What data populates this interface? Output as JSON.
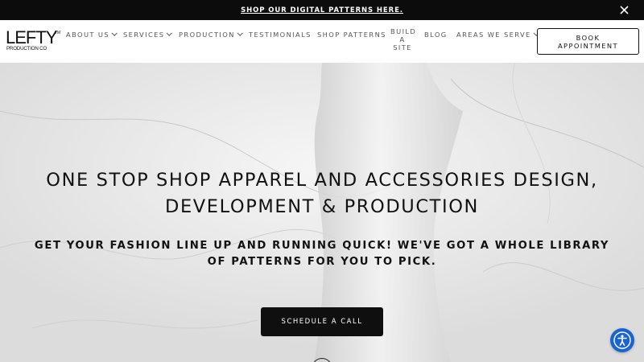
{
  "announcement": {
    "text": "SHOP OUR DIGITAL PATTERNS HERE.",
    "close_icon": "close-icon"
  },
  "header": {
    "logo": {
      "word": "LEFTY",
      "tm": "TM",
      "sub": "PRODUCTION CO"
    },
    "nav": [
      {
        "label": "ABOUT US",
        "has_dropdown": true
      },
      {
        "label": "SERVICES",
        "has_dropdown": true
      },
      {
        "label": "PRODUCTION",
        "has_dropdown": true
      },
      {
        "label": "TESTIMONIALS",
        "has_dropdown": false
      },
      {
        "label": "SHOP PATTERNS",
        "has_dropdown": false
      },
      {
        "label": "BUILD A SITE",
        "has_dropdown": false
      },
      {
        "label": "BLOG",
        "has_dropdown": false
      },
      {
        "label": "AREAS WE SERVE",
        "has_dropdown": true
      }
    ],
    "build_lines": [
      "BUILD",
      "A",
      "SITE"
    ],
    "book_button": "BOOK APPOINTMENT"
  },
  "hero": {
    "title": "ONE STOP SHOP APPAREL AND ACCESSORIES DESIGN, DEVELOPMENT & PRODUCTION",
    "subtitle": "GET YOUR FASHION LINE UP AND RUNNING QUICK! WE'VE GOT A WHOLE LIBRARY OF PATTERNS FOR YOU TO PICK.",
    "cta": "SCHEDULE A CALL"
  },
  "accessibility": {
    "icon": "accessibility-icon",
    "color": "#1a64d0"
  },
  "colors": {
    "bar": "#0c0c0c",
    "cta": "#0f0f0f",
    "hero_bg": "#e9e9e9"
  }
}
